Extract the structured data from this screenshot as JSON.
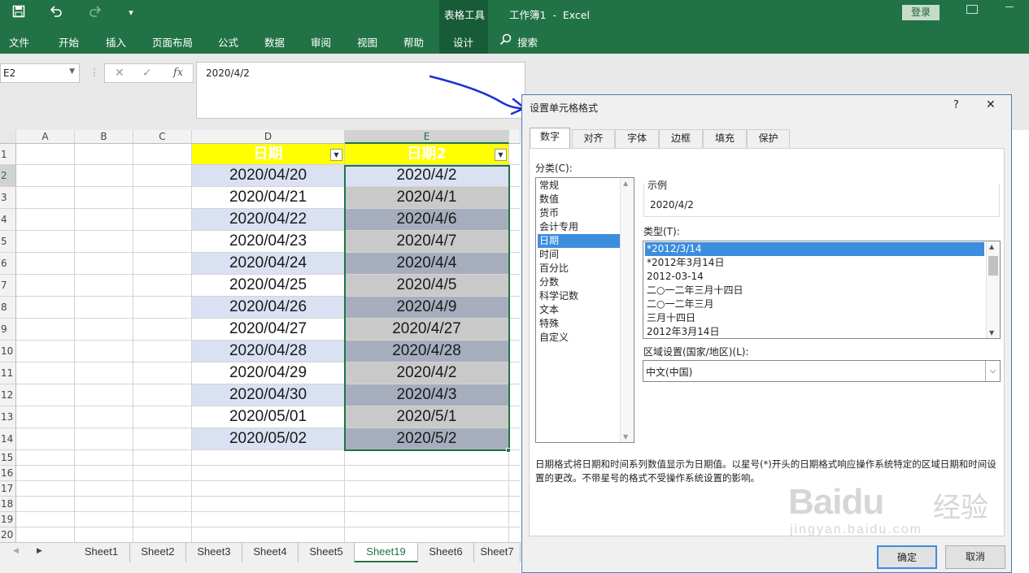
{
  "title_bar": {
    "context": "表格工具",
    "doc_title": "工作簿1  -  Excel",
    "login_label": "登录"
  },
  "colors": {
    "excel_green": "#217346",
    "header_yellow": "#ffff00",
    "band_light": "#d9e1f2",
    "band_gray": "#c9c9c9",
    "band_dark": "#a6aebd",
    "selection": "#217346"
  },
  "ribbon": {
    "tabs": [
      "文件",
      "开始",
      "插入",
      "页面布局",
      "公式",
      "数据",
      "审阅",
      "视图",
      "帮助",
      "设计"
    ],
    "search_label": "搜索",
    "active_tab": "设计"
  },
  "formula_bar": {
    "name_box": "E2",
    "formula": "2020/4/2",
    "fx_label": "fx"
  },
  "grid": {
    "columns": [
      "A",
      "B",
      "C",
      "D",
      "E"
    ],
    "row_numbers": [
      "1",
      "2",
      "3",
      "4",
      "5",
      "6",
      "7",
      "8",
      "9",
      "10",
      "11",
      "12",
      "13",
      "14",
      "15",
      "16",
      "17",
      "18",
      "19",
      "20"
    ],
    "header_d": "日期",
    "header_e": "日期2",
    "col_d": [
      "2020/04/20",
      "2020/04/21",
      "2020/04/22",
      "2020/04/23",
      "2020/04/24",
      "2020/04/25",
      "2020/04/26",
      "2020/04/27",
      "2020/04/28",
      "2020/04/29",
      "2020/04/30",
      "2020/05/01",
      "2020/05/02"
    ],
    "col_e": [
      "2020/4/2",
      "2020/4/1",
      "2020/4/6",
      "2020/4/7",
      "2020/4/4",
      "2020/4/5",
      "2020/4/9",
      "2020/4/27",
      "2020/4/28",
      "2020/4/2",
      "2020/4/3",
      "2020/5/1",
      "2020/5/2"
    ]
  },
  "sheets": {
    "tabs": [
      "Sheet1",
      "Sheet2",
      "Sheet3",
      "Sheet4",
      "Sheet5",
      "Sheet19",
      "Sheet6",
      "Sheet7"
    ],
    "active": "Sheet19"
  },
  "dialog": {
    "title": "设置单元格格式",
    "help": "?",
    "close": "✕",
    "tabs": [
      "数字",
      "对齐",
      "字体",
      "边框",
      "填充",
      "保护"
    ],
    "category_label": "分类(C):",
    "categories": [
      "常规",
      "数值",
      "货币",
      "会计专用",
      "日期",
      "时间",
      "百分比",
      "分数",
      "科学记数",
      "文本",
      "特殊",
      "自定义"
    ],
    "selected_category": "日期",
    "sample_label": "示例",
    "sample_value": "2020/4/2",
    "type_label": "类型(T):",
    "types": [
      "*2012/3/14",
      "*2012年3月14日",
      "2012-03-14",
      "二○一二年三月十四日",
      "二○一二年三月",
      "三月十四日",
      "2012年3月14日"
    ],
    "selected_type": "*2012/3/14",
    "locale_label": "区域设置(国家/地区)(L):",
    "locale_value": "中文(中国)",
    "description": "日期格式将日期和时间系列数值显示为日期值。以星号(*)开头的日期格式响应操作系统特定的区域日期和时间设置的更改。不带星号的格式不受操作系统设置的影响。",
    "ok": "确定",
    "cancel": "取消"
  },
  "watermark": {
    "brand": "Baidu",
    "brand_cn": "经验",
    "url": "jingyan.baidu.com"
  }
}
